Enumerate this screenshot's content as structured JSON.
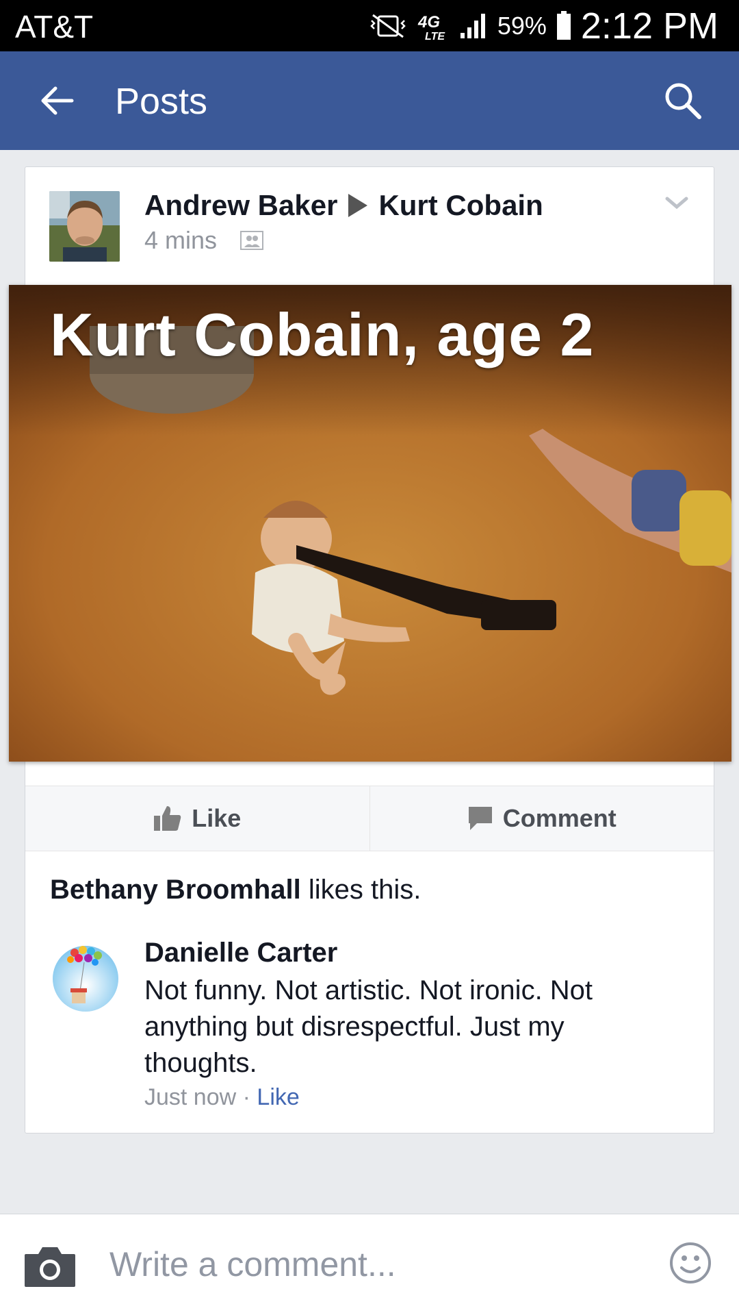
{
  "status_bar": {
    "carrier": "AT&T",
    "network": "4G LTE",
    "battery": "59%",
    "time": "2:12 PM"
  },
  "app_bar": {
    "title": "Posts",
    "back_icon": "arrow-left-icon",
    "search_icon": "search-icon"
  },
  "post": {
    "author": "Andrew Baker",
    "target": "Kurt Cobain",
    "time": "4 mins",
    "audience_icon": "friends-icon",
    "image_caption": "Kurt Cobain, age 2",
    "actions": {
      "like": "Like",
      "comment": "Comment"
    },
    "likes": {
      "name": "Bethany Broomhall",
      "suffix": " likes this."
    }
  },
  "comment": {
    "author": "Danielle Carter",
    "text": "Not funny. Not artistic. Not ironic. Not anything but disrespectful. Just my thoughts.",
    "time": "Just now",
    "separator": "·",
    "like": "Like"
  },
  "composer": {
    "placeholder": "Write a comment..."
  },
  "colors": {
    "brand": "#3b5998",
    "link": "#4267b2",
    "muted": "#90949c"
  }
}
